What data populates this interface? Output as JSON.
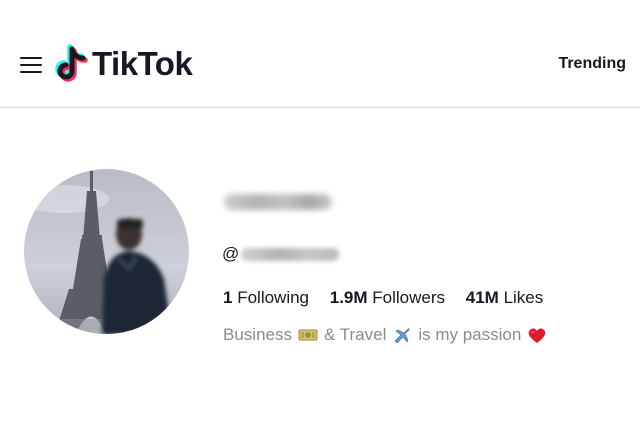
{
  "header": {
    "logo_text": "TikTok",
    "trending_label": "Trending"
  },
  "profile": {
    "handle_prefix": "@",
    "stats": [
      {
        "number": "1",
        "label": "Following"
      },
      {
        "number": "1.9M",
        "label": "Followers"
      },
      {
        "number": "41M",
        "label": "Likes"
      }
    ],
    "bio": {
      "part1": "Business",
      "part2": "& Travel",
      "part3": "is my passion",
      "emojis": [
        "money-emoji",
        "airplane-emoji",
        "heart-emoji"
      ]
    }
  },
  "colors": {
    "text_primary": "#161823",
    "text_secondary": "#8a8b91",
    "tiktok_cyan": "#25F4EE",
    "tiktok_pink": "#FE2C55",
    "heart_red": "#e0192d"
  }
}
